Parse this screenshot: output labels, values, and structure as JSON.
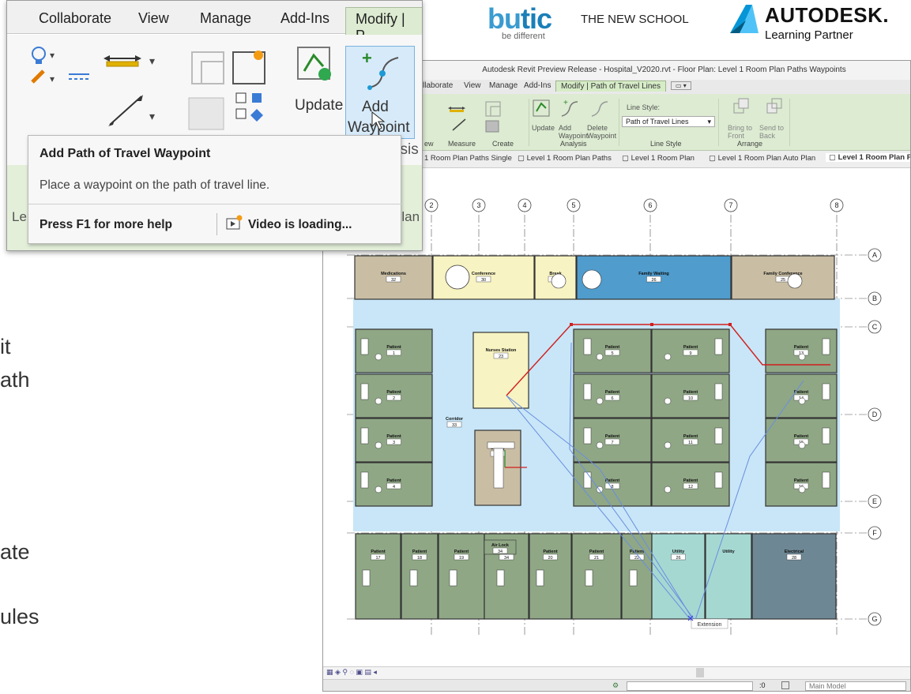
{
  "slide": {
    "fragments": [
      "it",
      "ath",
      "ate",
      "ules"
    ]
  },
  "logos": {
    "butic_word_a": "bu",
    "butic_word_b": "tic",
    "butic_school": "THE NEW SCHOOL",
    "butic_tag": "be different",
    "autodesk_word": "AUTODESK.",
    "autodesk_sub": "Learning Partner"
  },
  "revit": {
    "title": "Autodesk Revit Preview Release - Hospital_V2020.rvt - Floor Plan: Level 1 Room Plan Paths Waypoints",
    "tabs": [
      "llaborate",
      "View",
      "Manage",
      "Add-Ins",
      "Modify | Path of Travel Lines"
    ],
    "ribbon": {
      "line_style_label": "Line Style:",
      "line_style_value": "Path of Travel Lines",
      "buttons": {
        "update": "Update",
        "add_waypoint": "Add Waypoint",
        "delete_waypoint": "Delete Waypoint",
        "bring_to_front": "Bring to Front",
        "send_to_back": "Send to Back"
      },
      "groups": [
        "ew",
        "Measure",
        "Create",
        "Analysis",
        "Line Style",
        "Arrange"
      ]
    },
    "view_tabs": [
      "1 Room Plan Paths Single",
      "Level 1 Room Plan Paths",
      "Level 1 Room Plan",
      "Level 1 Room Plan Auto Plan",
      "Level 1 Room Plan Pa"
    ],
    "status": {
      "zoom": ":0",
      "model": "Main Model"
    },
    "floorplan": {
      "grid_columns": [
        "2",
        "3",
        "4",
        "5",
        "6",
        "7",
        "8"
      ],
      "grid_rows": [
        "A",
        "B",
        "C",
        "D",
        "E",
        "F",
        "G"
      ],
      "rooms": [
        {
          "name": "Medications",
          "number": "32"
        },
        {
          "name": "Conference",
          "number": "30"
        },
        {
          "name": "Break",
          "number": "31"
        },
        {
          "name": "Family Waiting",
          "number": "26"
        },
        {
          "name": "Family Conference",
          "number": "25"
        },
        {
          "name": "Patient",
          "number": "1"
        },
        {
          "name": "Patient",
          "number": "2"
        },
        {
          "name": "Patient",
          "number": "3"
        },
        {
          "name": "Patient",
          "number": "4"
        },
        {
          "name": "Nurses Station",
          "number": "23"
        },
        {
          "name": "Corridor",
          "number": "33"
        },
        {
          "name": "Supply",
          "number": "29"
        },
        {
          "name": "Patient",
          "number": "5"
        },
        {
          "name": "Patient",
          "number": "9"
        },
        {
          "name": "Patient",
          "number": "6"
        },
        {
          "name": "Patient",
          "number": "10"
        },
        {
          "name": "Patient",
          "number": "7"
        },
        {
          "name": "Patient",
          "number": "11"
        },
        {
          "name": "Patient",
          "number": "8"
        },
        {
          "name": "Patient",
          "number": "12"
        },
        {
          "name": "Patient",
          "number": "13"
        },
        {
          "name": "Patient",
          "number": "14"
        },
        {
          "name": "Patient",
          "number": "15"
        },
        {
          "name": "Patient",
          "number": "16"
        },
        {
          "name": "Patient",
          "number": "17"
        },
        {
          "name": "Patient",
          "number": "18"
        },
        {
          "name": "Air Lock",
          "number": "34"
        },
        {
          "name": "Patient",
          "number": "19"
        },
        {
          "name": "Patient",
          "number": "20"
        },
        {
          "name": "Patient",
          "number": "21"
        },
        {
          "name": "Patient",
          "number": "22"
        },
        {
          "name": "Utility",
          "number": "26"
        },
        {
          "name": "Utility",
          "number": ""
        },
        {
          "name": "Electrical",
          "number": "28"
        }
      ],
      "extension_tooltip": "Extension"
    }
  },
  "popup": {
    "tabs": [
      "Collaborate",
      "View",
      "Manage",
      "Add-Ins",
      "Modify | P"
    ],
    "update_label": "Update",
    "add_label": "Add",
    "waypoint_label": "Waypoint",
    "ysis_label": "ysis",
    "le_label": "Le",
    "plan_label": "Plan",
    "tooltip": {
      "title": "Add Path of Travel Waypoint",
      "description": "Place a waypoint on the path of travel line.",
      "help": "Press F1 for more help",
      "video": "Video is loading..."
    }
  },
  "colors": {
    "ribbon_green": "#dcebd1",
    "patient_room": "#8fa785",
    "corridor": "#c8e6f7",
    "nurses": "#f7f3c2",
    "family_waiting": "#4f9ccd",
    "utility": "#a6d8d2",
    "electrical": "#6e8794",
    "medications": "#c9bea4",
    "path_red": "#d21f1f",
    "path_blue": "#6a8ee0"
  }
}
